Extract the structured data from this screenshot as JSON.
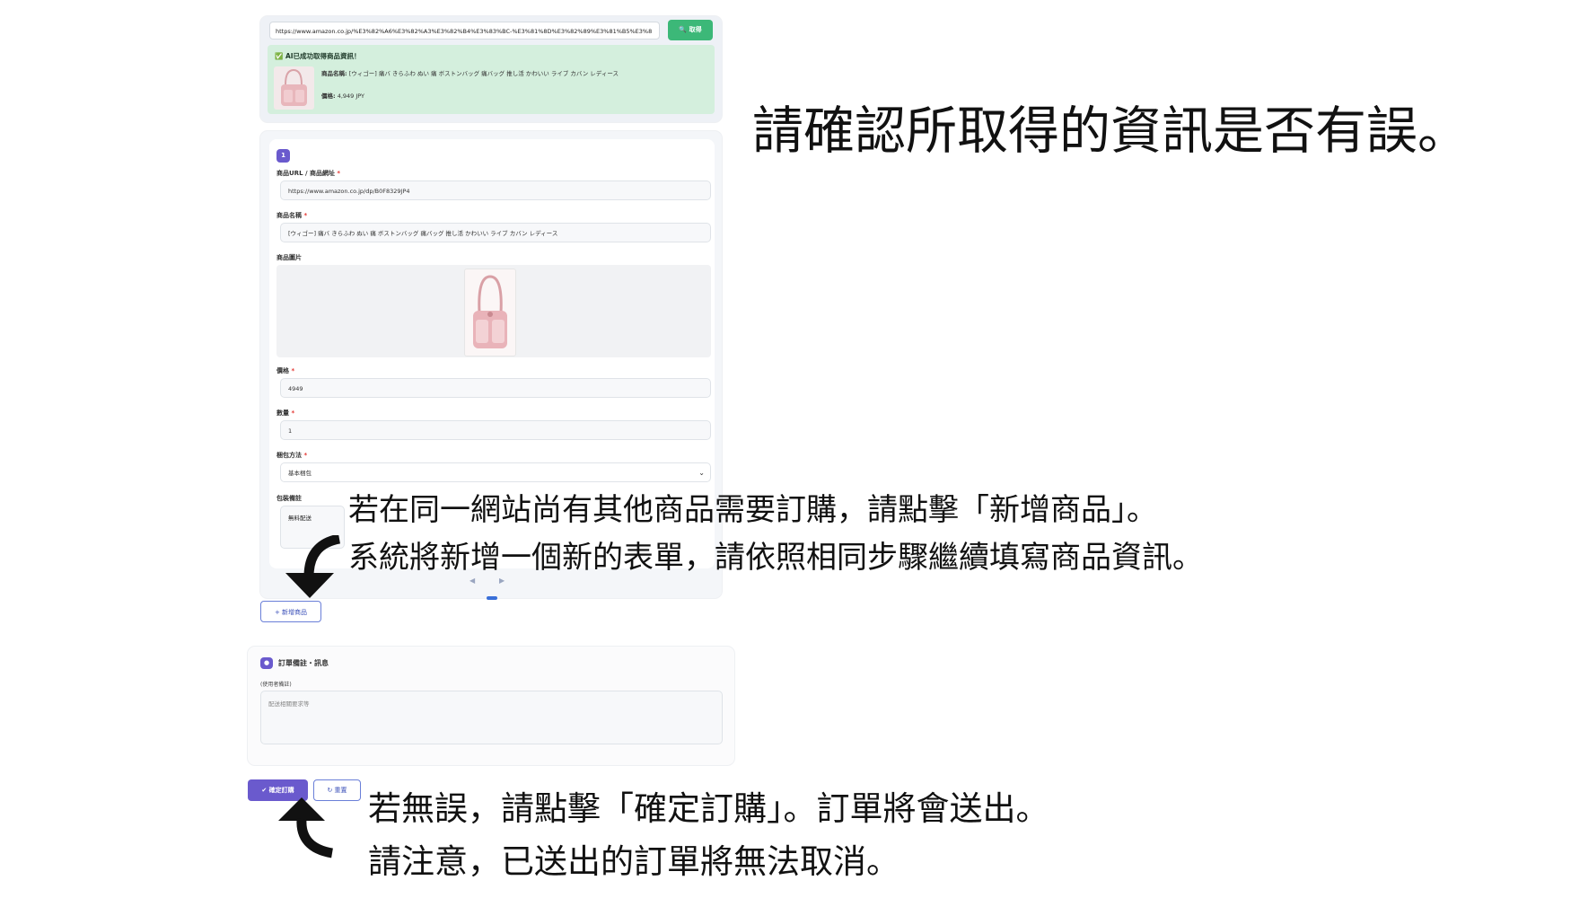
{
  "colors": {
    "accent": "#6a5acd",
    "success": "#3cb878",
    "success_bg": "#d4efdd"
  },
  "fetch": {
    "url_value": "https://www.amazon.co.jp/%E3%82%A6%E3%82%A3%E3%82%B4%E3%83%BC-%E3%81%8D%E3%82%89%E3%81%B5%E3%8",
    "fetch_button": "🔍 取得",
    "success_title": "✅ AI已成功取得商品資訊！",
    "name_label": "商品名稱:",
    "name_value": "[ウィゴー] 痛バ きらふわ ぬい 痛 ボストンバッグ 痛バッグ 推し活 かわいい ライブ カバン レディース",
    "price_label": "價格:",
    "price_value": "4,949 JPY"
  },
  "item": {
    "index": "1",
    "url_label": "商品URL / 商品網址",
    "url_value": "https://www.amazon.co.jp/dp/B0F8329JP4",
    "name_label": "商品名稱",
    "name_value": "[ウィゴー] 痛バ きらふわ ぬい 痛 ボストンバッグ 痛バッグ 推し活 かわいい ライブ カバン レディース",
    "image_label": "商品圖片",
    "price_label": "價格",
    "price_value": "4949",
    "qty_label": "數量",
    "qty_value": "1",
    "pack_label": "梱包方法",
    "pack_value": "基本梱包",
    "pack_note_label": "包裝備註",
    "pack_note_value": "無料配送"
  },
  "carousel": {
    "prev": "◀",
    "next": "▶"
  },
  "add_button": "+ 新增商品",
  "notes": {
    "title": "訂單備註・訊息",
    "sublabel": "(使用者備註)",
    "placeholder": "配送相關要求等"
  },
  "actions": {
    "confirm": "✔ 確定訂購",
    "reset": "重置",
    "reset_icon": "↻"
  },
  "annotations": {
    "confirm_info": "請確認所取得的資訊是否有誤。",
    "add_line1": "若在同一網站尚有其他商品需要訂購，請點擊「新增商品」。",
    "add_line2": "系統將新增一個新的表單，請依照相同步驟繼續填寫商品資訊。",
    "order_line1": "若無誤，請點擊「確定訂購」。訂單將會送出。",
    "order_line2": "請注意，已送出的訂單將無法取消。"
  }
}
